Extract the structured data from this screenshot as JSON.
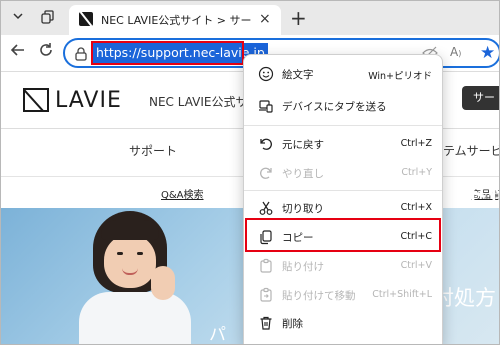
{
  "browser": {
    "tab": {
      "title": "NEC LAVIE公式サイト > サービス＆サポート",
      "close_glyph": "×"
    },
    "new_tab_glyph": "+",
    "address_bar": {
      "url": "https://support.nec-lavie.jp"
    },
    "icons": [
      "chevron-down-icon",
      "tab-actions-icon",
      "back-icon",
      "refresh-icon",
      "lock-icon",
      "hide-icon",
      "read-aloud-icon",
      "favorite-star-icon"
    ]
  },
  "page": {
    "logo_text": "LAVIE",
    "site_name": "NEC LAVIE公式サイト",
    "header_button": "サー",
    "nav": {
      "support": "サポート",
      "system": "ステムサービ"
    },
    "subnav": {
      "qa": "Q&A検索",
      "products": "商品情"
    },
    "hero": {
      "line1": "ート情",
      "line2": "対処方",
      "fragment": "パ"
    }
  },
  "context_menu": {
    "items": [
      {
        "label": "絵文字",
        "shortcut": "Win+ピリオド",
        "icon": "emoji-icon",
        "enabled": true
      },
      {
        "label": "デバイスにタブを送る",
        "shortcut": "",
        "icon": "send-to-device-icon",
        "enabled": true
      },
      {
        "label": "元に戻す",
        "shortcut": "Ctrl+Z",
        "icon": "undo-icon",
        "enabled": true
      },
      {
        "label": "やり直し",
        "shortcut": "Ctrl+Y",
        "icon": "redo-icon",
        "enabled": false
      },
      {
        "label": "切り取り",
        "shortcut": "Ctrl+X",
        "icon": "cut-icon",
        "enabled": true
      },
      {
        "label": "コピー",
        "shortcut": "Ctrl+C",
        "icon": "copy-icon",
        "enabled": true
      },
      {
        "label": "貼り付け",
        "shortcut": "Ctrl+V",
        "icon": "paste-icon",
        "enabled": false
      },
      {
        "label": "貼り付けて移動",
        "shortcut": "Ctrl+Shift+L",
        "icon": "paste-go-icon",
        "enabled": false
      },
      {
        "label": "削除",
        "shortcut": "",
        "icon": "delete-icon",
        "enabled": true
      }
    ]
  },
  "colors": {
    "accent": "#1b64d9",
    "highlight_box": "#e60012",
    "tabbar": "#e9e9e9"
  }
}
